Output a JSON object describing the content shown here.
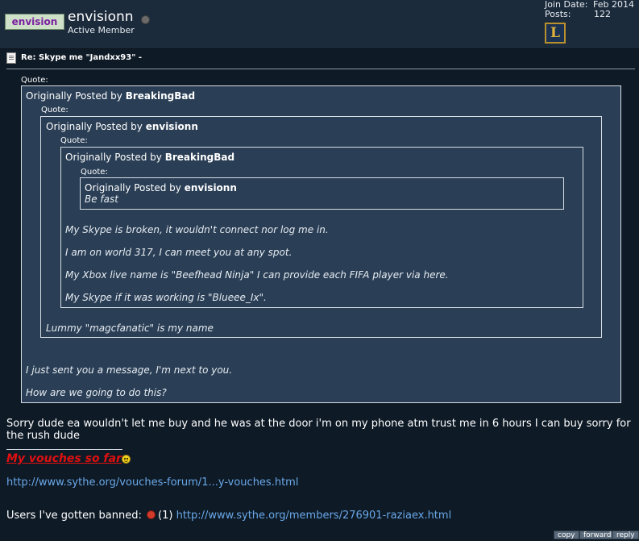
{
  "user": {
    "logo_text": "envision",
    "name": "envisionn",
    "title": "Active Member",
    "join_date_label": "Join Date:",
    "join_date": "Feb 2014",
    "posts_label": "Posts:",
    "posts": "122",
    "rank_icon": "L"
  },
  "post": {
    "title": "Re: Skype me \"Jandxx93\" -",
    "quote_label": "Quote:",
    "quote_prefix": "Originally Posted by",
    "q1_author": "BreakingBad",
    "q2_author": "envisionn",
    "q3_author": "BreakingBad",
    "q4_author": "envisionn",
    "q4_text": "Be fast",
    "q3_lines": [
      "My Skype is broken, it wouldn't connect nor log me in.",
      "I am on world 317, I can meet you at any spot.",
      "My Xbox live name is \"Beefhead Ninja\" I can provide each FIFA player via here.",
      "My Skype if it was working is \"Blueee_Ix\"."
    ],
    "q2_line": "Lummy \"magcfanatic\" is my name",
    "q1_lines": [
      "I just sent you a message, I'm next to you.",
      "How are we going to do this?"
    ],
    "body": "Sorry dude ea wouldn't let me buy and he was at the door i'm on my phone atm trust me in 6 hours I can buy sorry for the rush dude"
  },
  "signature": {
    "vouches_label": "My vouches so far",
    "vouches_url": "http://www.sythe.org/vouches-forum/1...y-vouches.html",
    "banned_label": "Users I've gotten banned:",
    "banned_count": "(1)",
    "banned_url": "http://www.sythe.org/members/276901-raziaex.html"
  },
  "actions": {
    "copy": "copy",
    "forward": "forward",
    "reply": "reply"
  }
}
